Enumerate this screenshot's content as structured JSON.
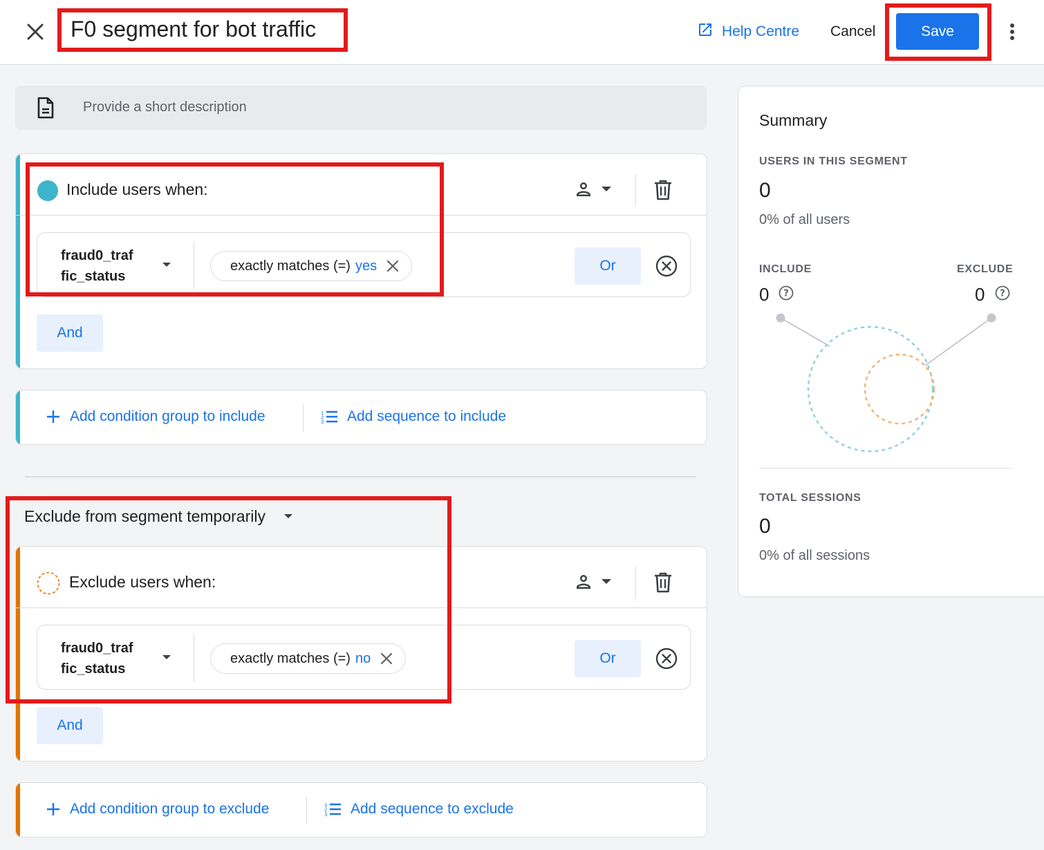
{
  "header": {
    "title": "F0 segment for bot traffic",
    "help_label": "Help Centre",
    "cancel_label": "Cancel",
    "save_label": "Save"
  },
  "description": {
    "placeholder": "Provide a short description"
  },
  "include_group": {
    "title": "Include users when:",
    "condition": {
      "dimension": "fraud0_traf fic_status",
      "operator": "exactly matches (=)",
      "value": "yes"
    },
    "or_label": "Or",
    "and_label": "And"
  },
  "include_actions": {
    "add_group": "Add condition group to include",
    "add_sequence": "Add sequence to include"
  },
  "exclude_mode": {
    "label": "Exclude from segment temporarily"
  },
  "exclude_group": {
    "title": "Exclude users when:",
    "condition": {
      "dimension": "fraud0_traf fic_status",
      "operator": "exactly matches (=)",
      "value": "no"
    },
    "or_label": "Or",
    "and_label": "And"
  },
  "exclude_actions": {
    "add_group": "Add condition group to exclude",
    "add_sequence": "Add sequence to exclude"
  },
  "summary": {
    "title": "Summary",
    "users_label": "USERS IN THIS SEGMENT",
    "users_value": "0",
    "users_pct": "0% of all users",
    "include_label": "INCLUDE",
    "include_value": "0",
    "exclude_label": "EXCLUDE",
    "exclude_value": "0",
    "sessions_label": "TOTAL SESSIONS",
    "sessions_value": "0",
    "sessions_pct": "0% of all sessions"
  },
  "colors": {
    "accent_blue": "#1a73e8",
    "include_teal": "#3eb5cc",
    "exclude_orange": "#e37400",
    "highlight_red": "#e31b1b"
  }
}
